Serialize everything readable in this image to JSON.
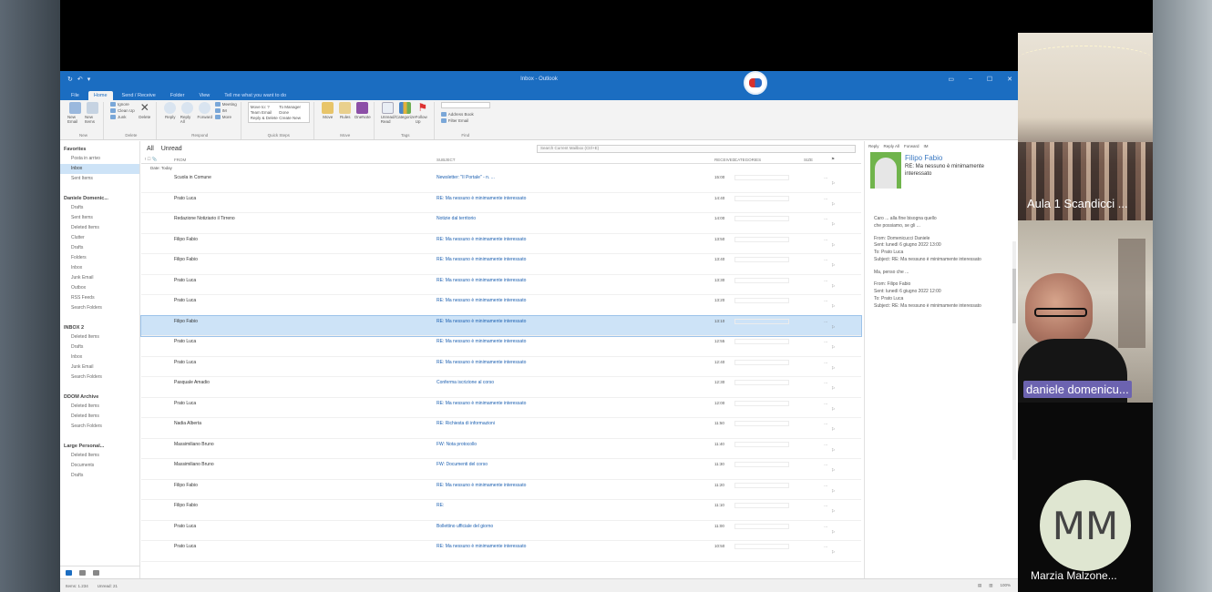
{
  "outlook": {
    "title_bar": "Inbox - Outlook",
    "tabs": [
      "File",
      "Home",
      "Send / Receive",
      "Folder",
      "View",
      "Tell me what you want to do"
    ],
    "ribbon_groups": [
      {
        "name": "New",
        "buttons": [
          "New Email",
          "New Items"
        ]
      },
      {
        "name": "Delete",
        "buttons": [
          "Ignore",
          "Clean Up",
          "Junk",
          "Delete"
        ]
      },
      {
        "name": "Respond",
        "buttons": [
          "Reply",
          "Reply All",
          "Forward",
          "Meeting",
          "IM",
          "More"
        ]
      },
      {
        "name": "Quick Steps",
        "buttons": [
          "Move to: ?",
          "Team Email",
          "Reply & Delete",
          "To Manager",
          "Done",
          "Create New"
        ]
      },
      {
        "name": "Move",
        "buttons": [
          "Move",
          "Rules",
          "OneNote"
        ]
      },
      {
        "name": "Tags",
        "buttons": [
          "Unread/ Read",
          "Categorize",
          "Follow Up"
        ]
      },
      {
        "name": "Find",
        "buttons": [
          "Search People",
          "Address Book",
          "Filter Email"
        ]
      }
    ],
    "folder_pane": {
      "favorites_header": "Favorites",
      "favorites": [
        "Posta in arrivo",
        "Inbox",
        "Sent Items"
      ],
      "sections": [
        {
          "header": "Daniele Domenic...",
          "items": [
            "Drafts",
            "Sent Items",
            "Deleted Items",
            "Clutter",
            "Drafts",
            "Folders",
            "Inbox",
            "Junk Email",
            "Outbox",
            "RSS Feeds",
            "Search Folders"
          ]
        },
        {
          "header": "INBOX 2",
          "items": [
            "Deleted Items",
            "Drafts",
            "Inbox",
            "Junk Email",
            "Search Folders"
          ]
        },
        {
          "header": "DDOM Archive",
          "items": [
            "Deleted Items",
            "Deleted Items",
            "Search Folders"
          ]
        },
        {
          "header": "Large Personal...",
          "items": [
            "Deleted Items",
            "Documents",
            "Drafts"
          ]
        }
      ]
    },
    "mail_list": {
      "view_tabs": [
        "All",
        "Unread"
      ],
      "search_placeholder": "Search Current Mailbox (Ctrl+E)",
      "search_scope": "Current Mailbox",
      "columns": [
        "FROM",
        "SUBJECT",
        "RECEIVED",
        "CATEGORIES",
        "SIZE"
      ],
      "group_header": "Date: Today",
      "rows": [
        {
          "from": "Scuola in Comune",
          "subject": "Newsletter: \"Il Portale\" - n. ...",
          "date": "15:00",
          "size": "..."
        },
        {
          "from": "Prato Luca",
          "subject": "RE: Ma nessuno è minimamente interessato",
          "date": "14:40",
          "size": "..."
        },
        {
          "from": "Redazione Notiziario il Tirreno",
          "subject": "Notizie dal territorio",
          "date": "14:00",
          "size": "..."
        },
        {
          "from": "Filipo Fabio",
          "subject": "RE: Ma nessuno è minimamente interessato",
          "date": "13:50",
          "size": "..."
        },
        {
          "from": "Filipo Fabio",
          "subject": "RE: Ma nessuno è minimamente interessato",
          "date": "13:40",
          "size": "..."
        },
        {
          "from": "Prato Luca",
          "subject": "RE: Ma nessuno è minimamente interessato",
          "date": "13:30",
          "size": "..."
        },
        {
          "from": "Prato Luca",
          "subject": "RE: Ma nessuno è minimamente interessato",
          "date": "13:20",
          "size": "..."
        },
        {
          "from": "Filipo Fabio",
          "subject": "RE: Ma nessuno è minimamente interessato",
          "date": "13:10",
          "size": "...",
          "selected": true
        },
        {
          "from": "Prato Luca",
          "subject": "RE: Ma nessuno è minimamente interessato",
          "date": "12:55",
          "size": "..."
        },
        {
          "from": "Prato Luca",
          "subject": "RE: Ma nessuno è minimamente interessato",
          "date": "12:40",
          "size": "..."
        },
        {
          "from": "Pasquale Amadio",
          "subject": "Conferma iscrizione al corso",
          "date": "12:30",
          "size": "..."
        },
        {
          "from": "Prato Luca",
          "subject": "RE: Ma nessuno è minimamente interessato",
          "date": "12:00",
          "size": "..."
        },
        {
          "from": "Nadia Alberta",
          "subject": "RE: Richiesta di informazioni",
          "date": "11:50",
          "size": "..."
        },
        {
          "from": "Massimiliano Bruno",
          "subject": "FW: Nota protocollo",
          "date": "11:40",
          "size": "..."
        },
        {
          "from": "Massimiliano Bruno",
          "subject": "FW: Documenti del corso",
          "date": "11:30",
          "size": "..."
        },
        {
          "from": "Filipo Fabio",
          "subject": "RE: Ma nessuno è minimamente interessato",
          "date": "11:20",
          "size": "..."
        },
        {
          "from": "Filipo Fabio",
          "subject": "RE:",
          "date": "11:10",
          "size": "..."
        },
        {
          "from": "Prato Luca",
          "subject": "Bollettino ufficiale del giorno",
          "date": "11:00",
          "size": "..."
        },
        {
          "from": "Prato Luca",
          "subject": "RE: Ma nessuno è minimamente interessato",
          "date": "10:50",
          "size": "..."
        }
      ]
    },
    "reading_pane": {
      "actions": [
        "Reply",
        "Reply All",
        "Forward",
        "IM"
      ],
      "sender": "Filipo Fabio",
      "subject": "RE: Ma nessuno è minimamente interessato",
      "body_lines": [
        "Caro ... alla fine bisogna quello",
        "che possiamo, se gli ...",
        "",
        "From: Domenicucci Daniele",
        "Sent: lunedì 6 giugno 2022 13:00",
        "To: Prato Luca",
        "Subject: RE: Ma nessuno è minimamente interessato",
        "",
        "Ma, penso che ...",
        "",
        "From: Filipo Fabio",
        "Sent: lunedì 6 giugno 2022 12:00",
        "To: Prato Luca",
        "Subject: RE: Ma nessuno è minimamente interessato"
      ]
    },
    "status": {
      "items": "Items: 1.234",
      "unread": "Unread: 21",
      "zoom": "100%"
    }
  },
  "participants": [
    {
      "name": "Aula 1 Scandicci ..."
    },
    {
      "name": "daniele domenicu..."
    },
    {
      "name": "Marzia Malzone...",
      "initials": "MM"
    }
  ]
}
